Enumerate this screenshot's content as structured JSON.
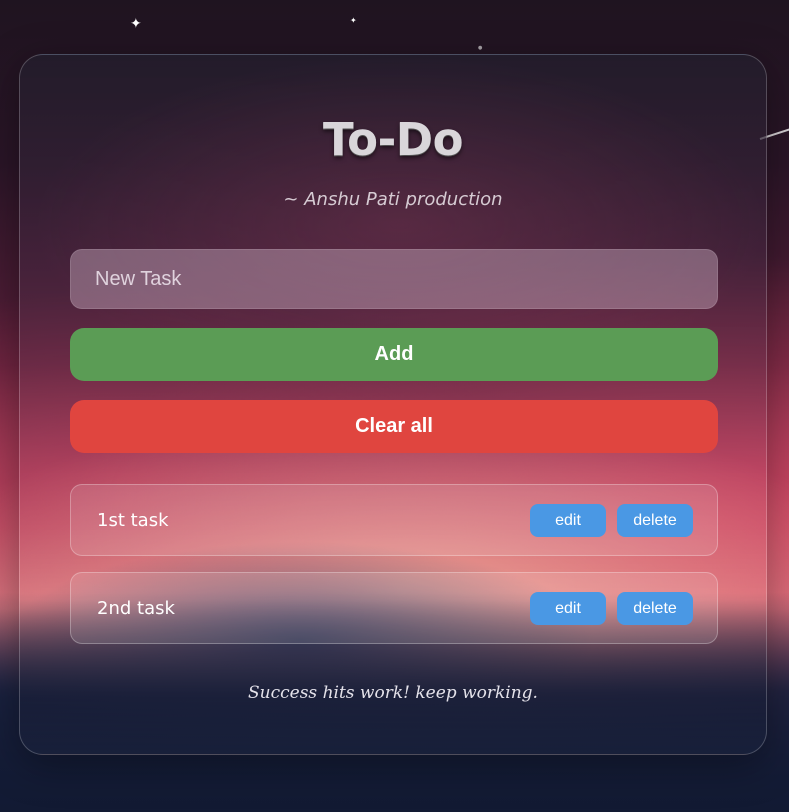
{
  "app": {
    "title": "To-Do",
    "subtitle": "~ Anshu Pati production",
    "footer": "Success hits work! keep working."
  },
  "input": {
    "placeholder": "New Task",
    "value": ""
  },
  "buttons": {
    "add_label": "Add",
    "clear_label": "Clear all"
  },
  "tasks": [
    {
      "text": "1st task",
      "edit_label": "edit",
      "delete_label": "delete"
    },
    {
      "text": "2nd task",
      "edit_label": "edit",
      "delete_label": "delete"
    }
  ],
  "colors": {
    "add_button": "#5b9c55",
    "clear_button": "#e0453f",
    "task_button": "#4a98e4"
  }
}
